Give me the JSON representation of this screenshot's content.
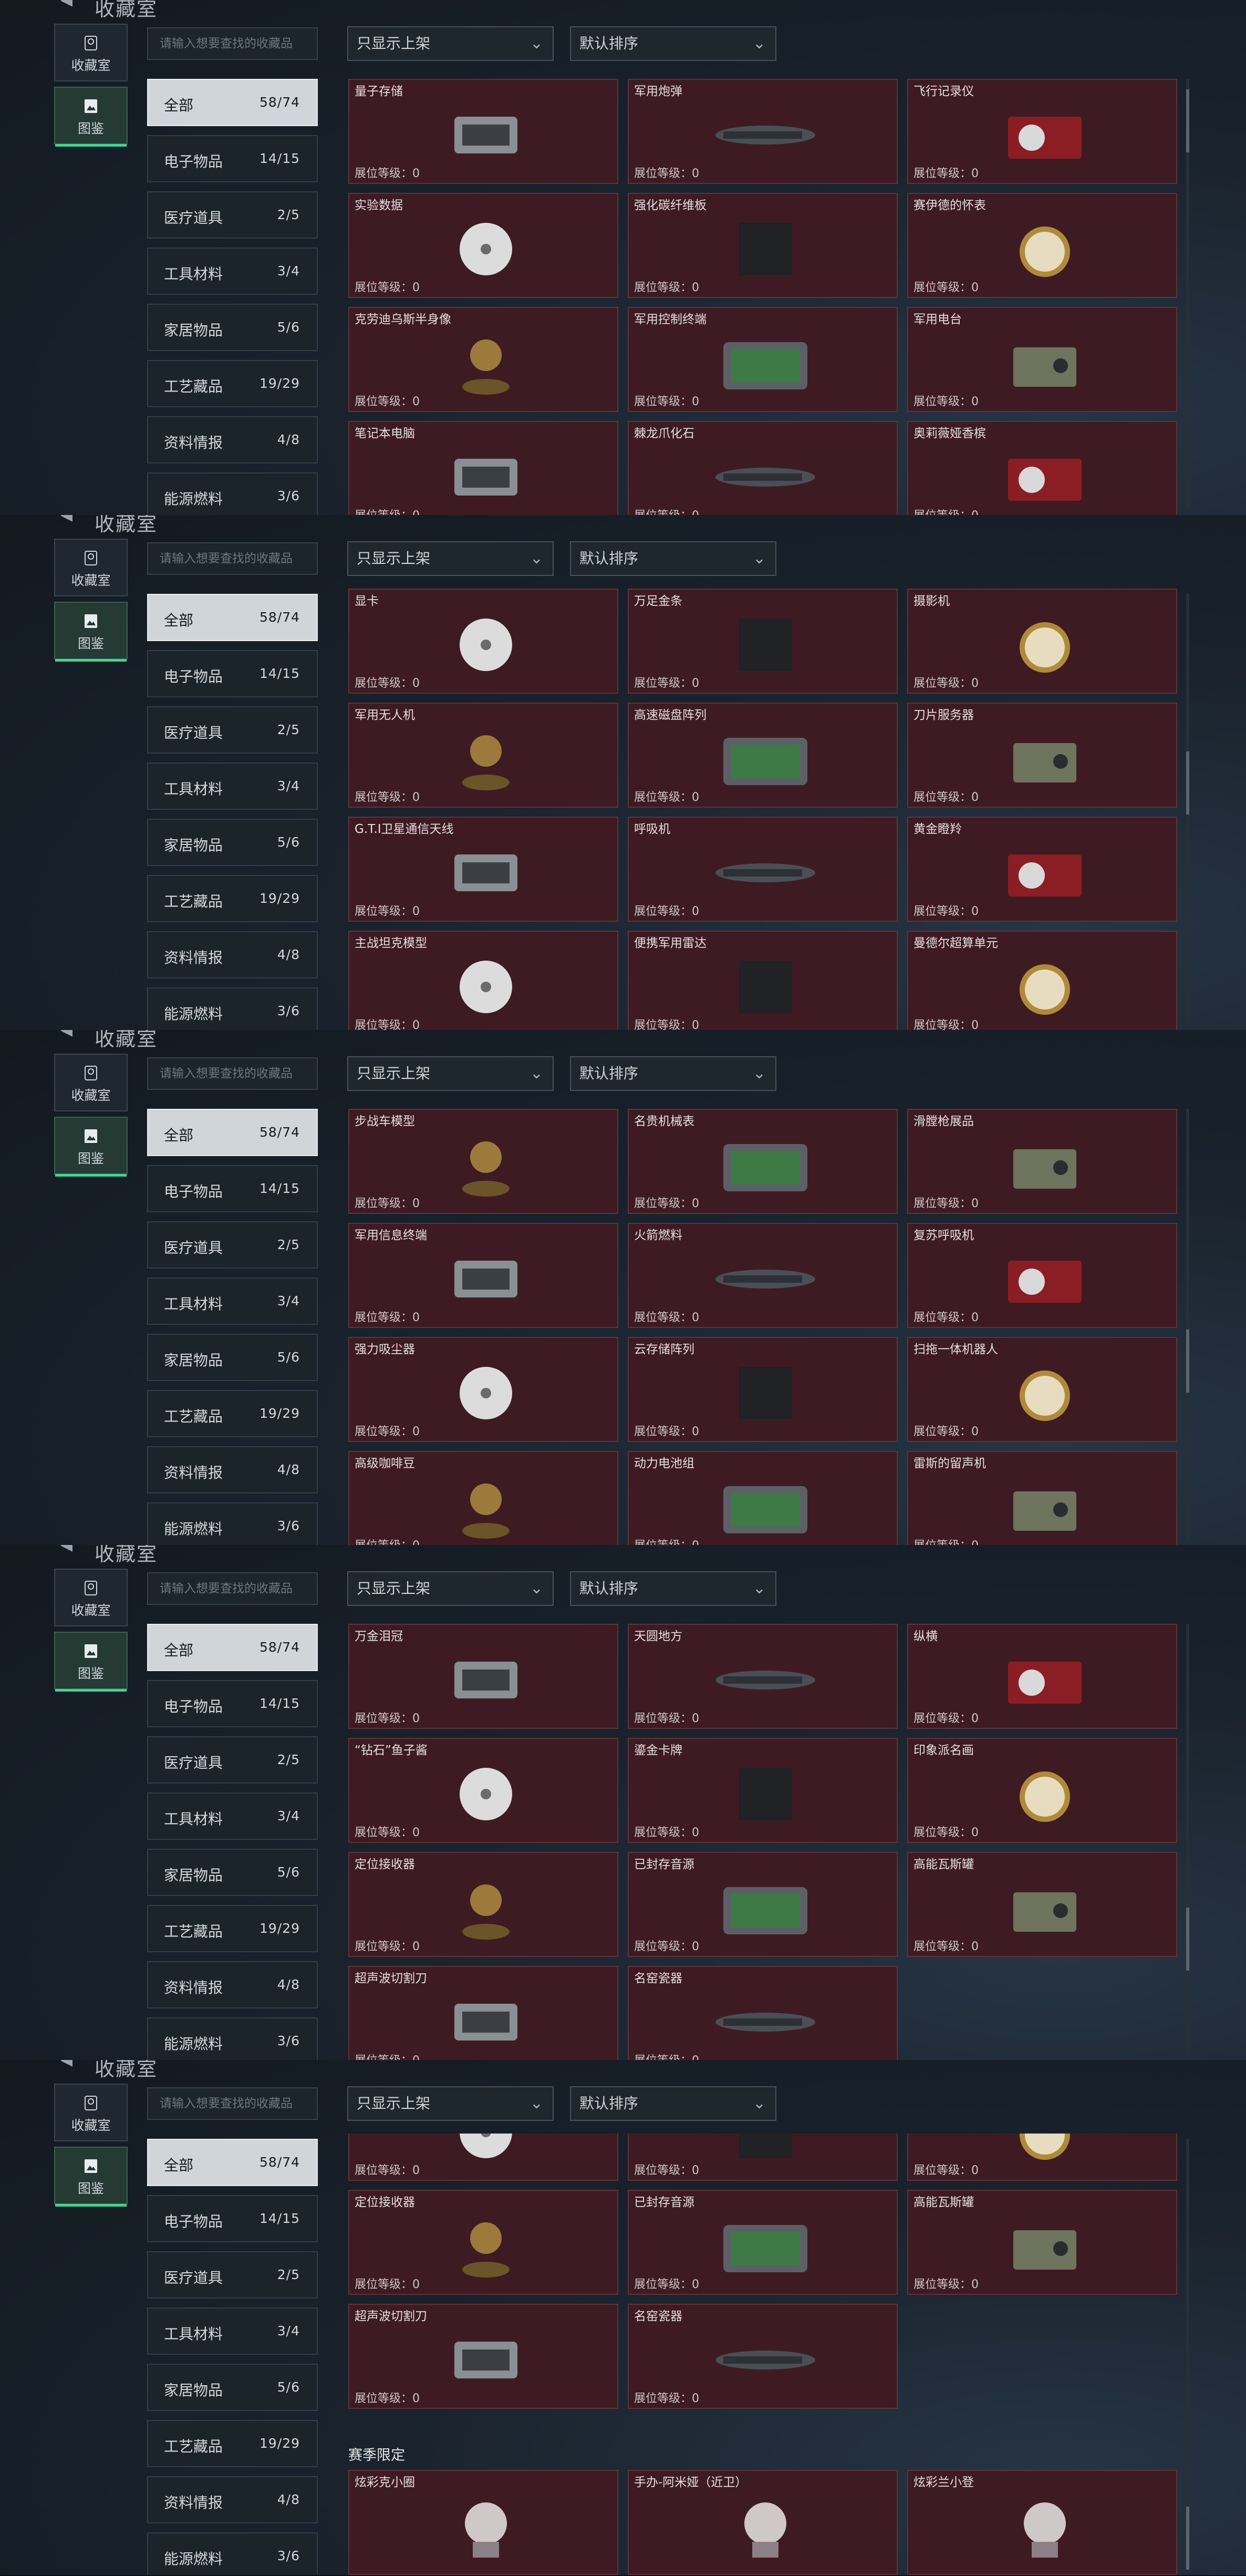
{
  "header": {
    "title": "收藏室"
  },
  "rail": {
    "collection_label": "收藏室",
    "gallery_label": "图鉴"
  },
  "search": {
    "placeholder": "请输入想要查找的收藏品"
  },
  "filter": {
    "show_label": "只显示上架",
    "sort_label": "默认排序"
  },
  "level_prefix": "展位等级：0",
  "categories": [
    {
      "label": "全部",
      "count": "58/74"
    },
    {
      "label": "电子物品",
      "count": "14/15"
    },
    {
      "label": "医疗道具",
      "count": "2/5"
    },
    {
      "label": "工具材料",
      "count": "3/4"
    },
    {
      "label": "家居物品",
      "count": "5/6"
    },
    {
      "label": "工艺藏品",
      "count": "19/29"
    },
    {
      "label": "资料情报",
      "count": "4/8"
    },
    {
      "label": "能源燃料",
      "count": "3/6"
    }
  ],
  "season_section": {
    "title": "赛季限定"
  },
  "panels": [
    {
      "rows": [
        [
          "量子存储",
          "军用炮弹",
          "飞行记录仪"
        ],
        [
          "实验数据",
          "强化碳纤维板",
          "赛伊德的怀表"
        ],
        [
          "克劳迪乌斯半身像",
          "军用控制终端",
          "军用电台"
        ],
        [
          "笔记本电脑",
          "棘龙爪化石",
          "奥莉薇娅香槟"
        ]
      ]
    },
    {
      "rows": [
        [
          "显卡",
          "万足金条",
          "摄影机"
        ],
        [
          "军用无人机",
          "高速磁盘阵列",
          "刀片服务器"
        ],
        [
          "G.T.I卫星通信天线",
          "呼吸机",
          "黄金瞪羚"
        ],
        [
          "主战坦克模型",
          "便携军用雷达",
          "曼德尔超算单元"
        ]
      ]
    },
    {
      "rows": [
        [
          "步战车模型",
          "名贵机械表",
          "滑膛枪展品"
        ],
        [
          "军用信息终端",
          "火箭燃料",
          "复苏呼吸机"
        ],
        [
          "强力吸尘器",
          "云存储阵列",
          "扫拖一体机器人"
        ],
        [
          "高级咖啡豆",
          "动力电池组",
          "雷斯的留声机"
        ]
      ]
    },
    {
      "rows": [
        [
          "万金泪冠",
          "天圆地方",
          "纵横"
        ],
        [
          "“钻石”鱼子酱",
          "鎏金卡牌",
          "印象派名画"
        ],
        [
          "定位接收器",
          "已封存音源",
          "高能瓦斯罐"
        ],
        [
          "超声波切割刀",
          "名窑瓷器"
        ]
      ]
    },
    {
      "rows": [
        [
          "",
          "",
          ""
        ],
        [
          "定位接收器",
          "已封存音源",
          "高能瓦斯罐"
        ],
        [
          "超声波切割刀",
          "名窑瓷器"
        ]
      ],
      "season_rows": [
        [
          "炫彩克小圈",
          "手办-阿米娅（近卫）",
          "炫彩兰小登"
        ]
      ]
    }
  ],
  "colors": {
    "accent": "#3fd597",
    "card_bg": "#3e1b22",
    "card_border": "#5e3239"
  }
}
